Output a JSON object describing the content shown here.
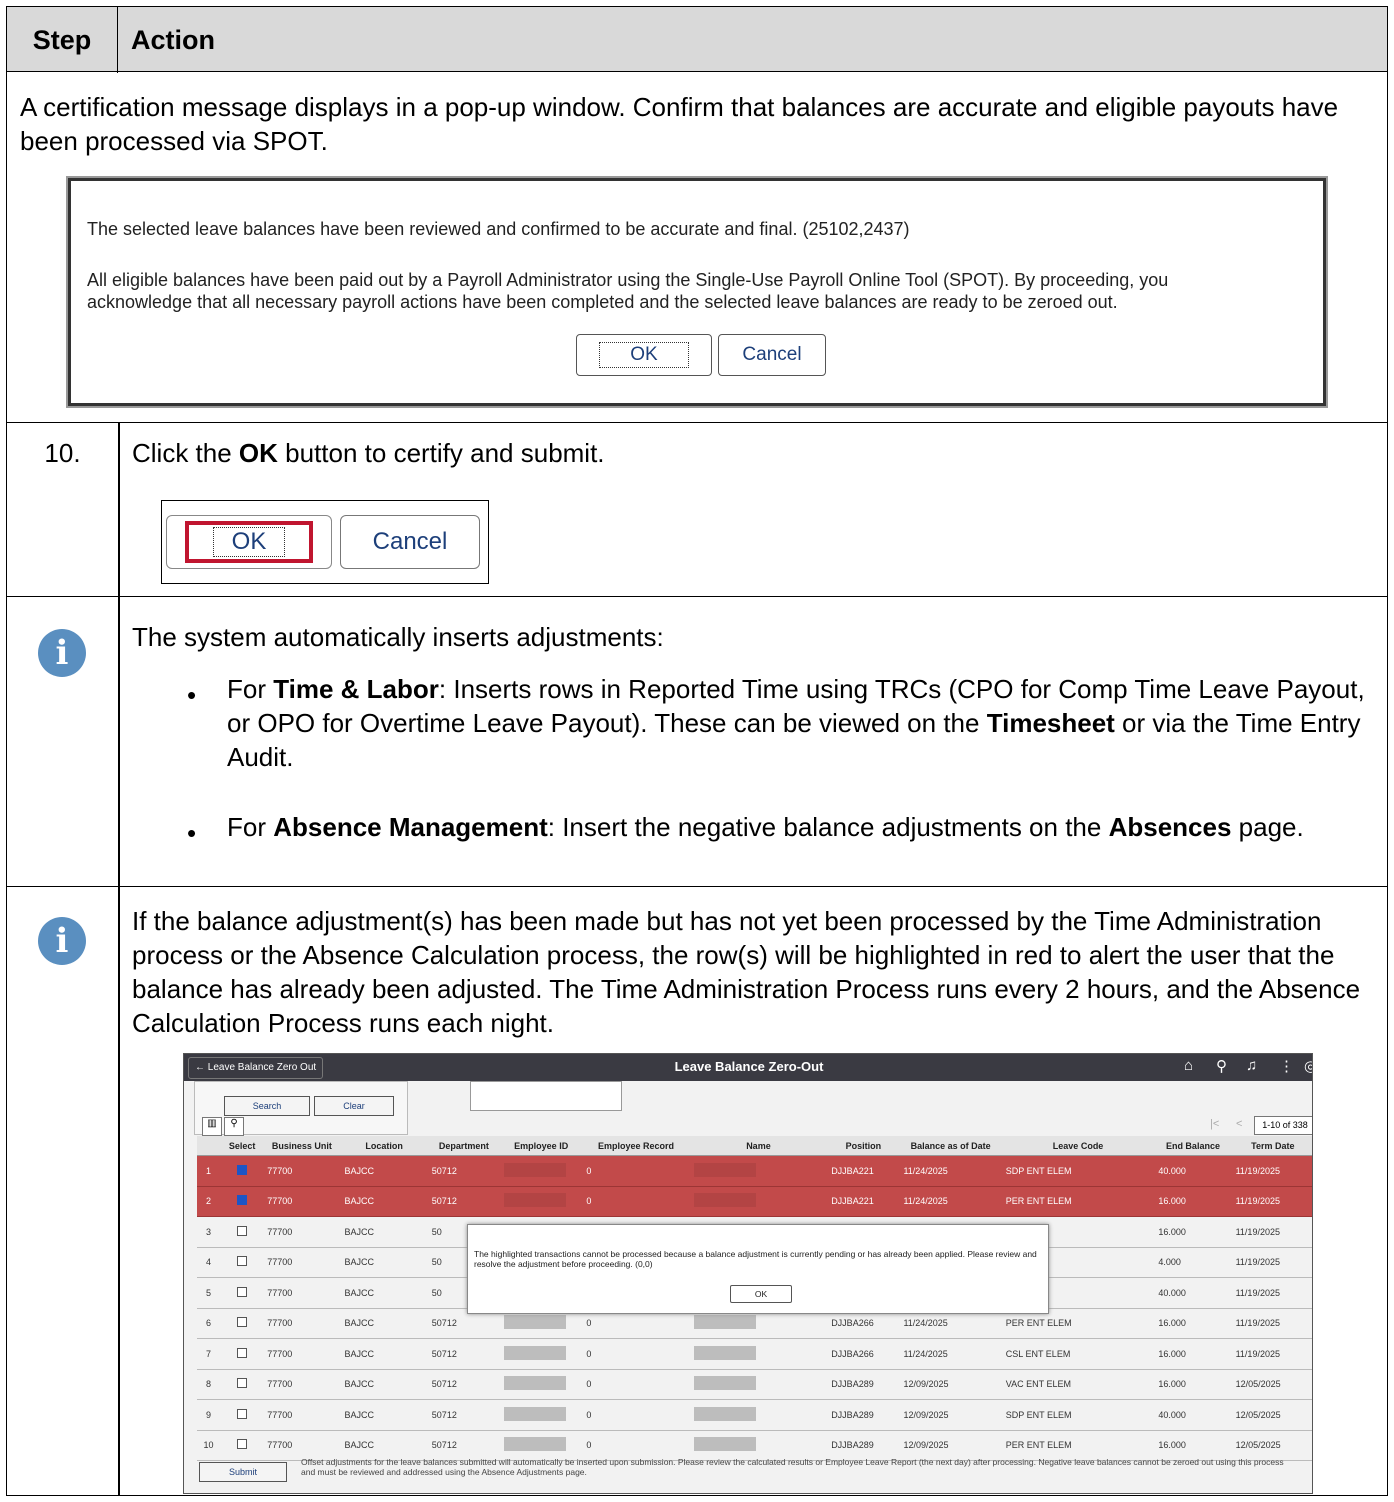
{
  "header": {
    "step": "Step",
    "action": "Action"
  },
  "intro": {
    "text": "A certification message displays in a pop-up window. Confirm that balances are accurate and eligible payouts have been processed via SPOT.",
    "popup": {
      "line1": "The selected leave balances have been reviewed and confirmed to be accurate and final. (25102,2437)",
      "line2": "All eligible balances have been paid out by a Payroll Administrator using the Single-Use Payroll Online Tool (SPOT). By proceeding, you acknowledge that all necessary payroll actions have been completed and the selected leave balances are ready to be zeroed out.",
      "ok": "OK",
      "cancel": "Cancel"
    }
  },
  "step10": {
    "number": "10.",
    "pre": "Click the ",
    "bold": "OK",
    "post": " button to certify and submit.",
    "ok": "OK",
    "cancel": "Cancel"
  },
  "info1": {
    "lead": "The system automatically inserts adjustments:",
    "b1_pre": "For ",
    "b1_bold1": "Time & Labor",
    "b1_mid": ": Inserts rows in Reported Time using TRCs (CPO for Comp Time Leave Payout, or OPO for Overtime Leave Payout). These can be viewed on the ",
    "b1_bold2": "Timesheet",
    "b1_post": " or via the Time Entry Audit.",
    "b2_pre": "For ",
    "b2_bold1": "Absence Management",
    "b2_mid": ": Insert the negative balance adjustments on the ",
    "b2_bold2": "Absences",
    "b2_post": " page."
  },
  "info2": {
    "text": "If the balance adjustment(s) has been made but has not yet been processed by the Time Administration process or the Absence Calculation process, the row(s) will be highlighted in red to alert the user that the balance has already been adjusted. The Time Administration Process runs every 2 hours, and the Absence Calculation Process runs each night."
  },
  "screenshot": {
    "back": "← Leave Balance Zero Out",
    "title": "Leave Balance Zero-Out",
    "search": "Search",
    "clear": "Clear",
    "pager": "1-10 of 338",
    "columns": [
      "",
      "Select",
      "Business Unit",
      "Location",
      "Department",
      "Employee ID",
      "Employee Record",
      "Name",
      "Position",
      "Balance as of Date",
      "Leave Code",
      "End Balance",
      "Term Date"
    ],
    "rows": [
      {
        "n": "1",
        "sel": true,
        "bu": "77700",
        "loc": "BAJCC",
        "dept": "50712",
        "rec": "0",
        "pos": "DJJBA221",
        "date": "11/24/2025",
        "code": "SDP ENT ELEM",
        "bal": "40.000",
        "term": "11/19/2025",
        "red": true
      },
      {
        "n": "2",
        "sel": true,
        "bu": "77700",
        "loc": "BAJCC",
        "dept": "50712",
        "rec": "0",
        "pos": "DJJBA221",
        "date": "11/24/2025",
        "code": "PER ENT ELEM",
        "bal": "16.000",
        "term": "11/19/2025",
        "red": true
      },
      {
        "n": "3",
        "sel": false,
        "bu": "77700",
        "loc": "BAJCC",
        "dept": "50",
        "rec": "",
        "pos": "",
        "date": "",
        "code": "NT ELEM",
        "bal": "16.000",
        "term": "11/19/2025",
        "red": false
      },
      {
        "n": "4",
        "sel": false,
        "bu": "77700",
        "loc": "BAJCC",
        "dept": "50",
        "rec": "",
        "pos": "",
        "date": "",
        "code": "NT ELEM",
        "bal": "4.000",
        "term": "11/19/2025",
        "red": false
      },
      {
        "n": "5",
        "sel": false,
        "bu": "77700",
        "loc": "BAJCC",
        "dept": "50",
        "rec": "",
        "pos": "",
        "date": "",
        "code": "NT ELEM",
        "bal": "40.000",
        "term": "11/19/2025",
        "red": false
      },
      {
        "n": "6",
        "sel": false,
        "bu": "77700",
        "loc": "BAJCC",
        "dept": "50712",
        "rec": "0",
        "pos": "DJJBA266",
        "date": "11/24/2025",
        "code": "PER ENT ELEM",
        "bal": "16.000",
        "term": "11/19/2025",
        "red": false
      },
      {
        "n": "7",
        "sel": false,
        "bu": "77700",
        "loc": "BAJCC",
        "dept": "50712",
        "rec": "0",
        "pos": "DJJBA266",
        "date": "11/24/2025",
        "code": "CSL ENT ELEM",
        "bal": "16.000",
        "term": "11/19/2025",
        "red": false
      },
      {
        "n": "8",
        "sel": false,
        "bu": "77700",
        "loc": "BAJCC",
        "dept": "50712",
        "rec": "0",
        "pos": "DJJBA289",
        "date": "12/09/2025",
        "code": "VAC ENT ELEM",
        "bal": "16.000",
        "term": "12/05/2025",
        "red": false
      },
      {
        "n": "9",
        "sel": false,
        "bu": "77700",
        "loc": "BAJCC",
        "dept": "50712",
        "rec": "0",
        "pos": "DJJBA289",
        "date": "12/09/2025",
        "code": "SDP ENT ELEM",
        "bal": "40.000",
        "term": "12/05/2025",
        "red": false
      },
      {
        "n": "10",
        "sel": false,
        "bu": "77700",
        "loc": "BAJCC",
        "dept": "50712",
        "rec": "0",
        "pos": "DJJBA289",
        "date": "12/09/2025",
        "code": "PER ENT ELEM",
        "bal": "16.000",
        "term": "12/05/2025",
        "red": false
      }
    ],
    "dialog": {
      "text": "The highlighted transactions cannot be processed because a balance adjustment is currently pending or has already been applied. Please review and resolve the adjustment before proceeding. (0,0)",
      "ok": "OK"
    },
    "submit": "Submit",
    "footer": "Offset adjustments for the leave balances submitted will automatically be inserted upon submission. Please review the calculated results or Employee Leave Report (the next day) after processing. Negative leave balances cannot be zeroed out using this process and must be reviewed and addressed using the Absence Adjustments page."
  }
}
